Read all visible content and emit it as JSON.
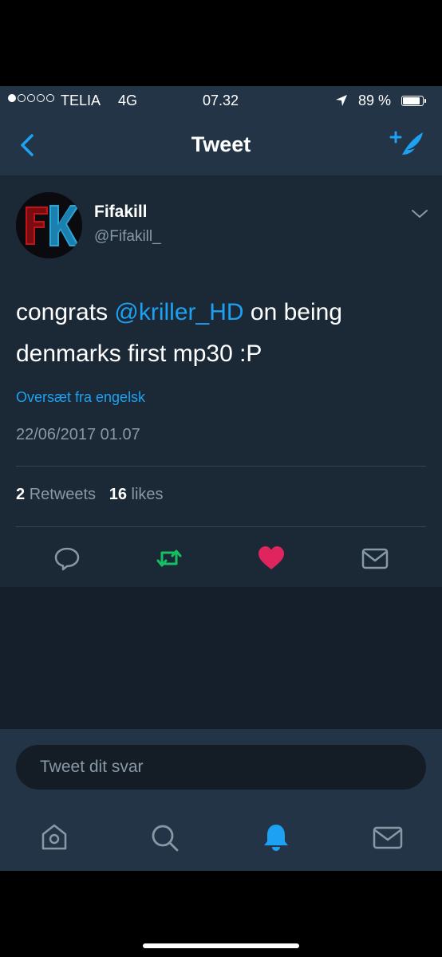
{
  "status_bar": {
    "signal_filled": 1,
    "signal_total": 5,
    "carrier": "TELIA",
    "network": "4G",
    "time": "07.32",
    "battery_percent": "89 %",
    "battery_level": 0.89
  },
  "nav": {
    "title": "Tweet",
    "back_icon": "chevron-left-icon",
    "compose_icon": "compose-tweet-icon"
  },
  "tweet": {
    "avatar_text": "FK",
    "display_name": "Fifakill",
    "handle": "@Fifakill_",
    "text_before": "congrats ",
    "mention": "@kriller_HD",
    "text_after": " on being denmarks first mp30 :P",
    "translate_link": "Oversæt fra engelsk",
    "timestamp": "22/06/2017 01.07",
    "retweet_count": "2",
    "retweet_label": "Retweets",
    "like_count": "16",
    "like_label": "likes"
  },
  "actions": [
    {
      "icon": "reply-icon"
    },
    {
      "icon": "retweet-icon",
      "color": "#17bf63"
    },
    {
      "icon": "heart-icon",
      "color": "#e0245e"
    },
    {
      "icon": "direct-message-icon"
    }
  ],
  "reply": {
    "placeholder": "Tweet dit svar"
  },
  "tabs": [
    {
      "icon": "home-icon"
    },
    {
      "icon": "search-icon"
    },
    {
      "icon": "notifications-icon",
      "active": true
    },
    {
      "icon": "messages-icon"
    }
  ],
  "colors": {
    "accent": "#1da1f2",
    "background": "#1b2836",
    "bar": "#243447"
  }
}
